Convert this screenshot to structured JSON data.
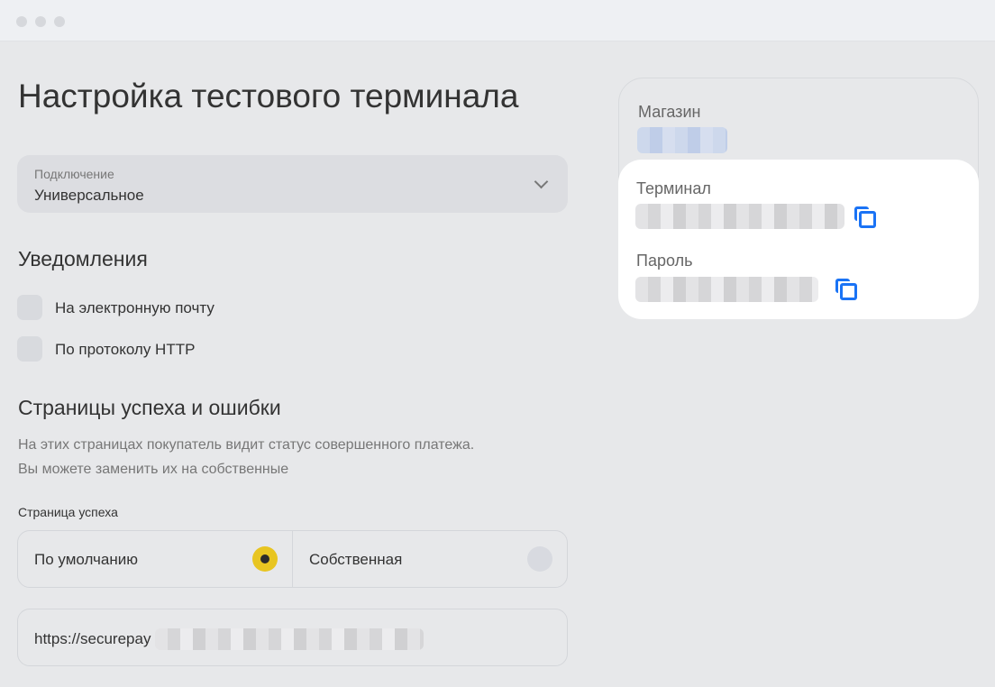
{
  "title": "Настройка тестового терминала",
  "connection": {
    "label": "Подключение",
    "value": "Универсальное"
  },
  "notifications": {
    "heading": "Уведомления",
    "options": [
      {
        "label": "На электронную почту",
        "checked": false
      },
      {
        "label": "По протоколу HTTP",
        "checked": false
      }
    ]
  },
  "pages": {
    "heading": "Страницы успеха и ошибки",
    "desc_line1": "На этих страницах покупатель видит статус совершенного платежа.",
    "desc_line2": "Вы можете заменить их на собственные",
    "success_label": "Страница успеха",
    "options": [
      {
        "label": "По умолчанию",
        "selected": true
      },
      {
        "label": "Собственная",
        "selected": false
      }
    ],
    "url_value": "https://securepay"
  },
  "credentials": {
    "shop_label": "Магазин",
    "terminal_label": "Терминал",
    "password_label": "Пароль"
  },
  "colors": {
    "accent": "#e8c521",
    "copy": "#1a73f5"
  }
}
